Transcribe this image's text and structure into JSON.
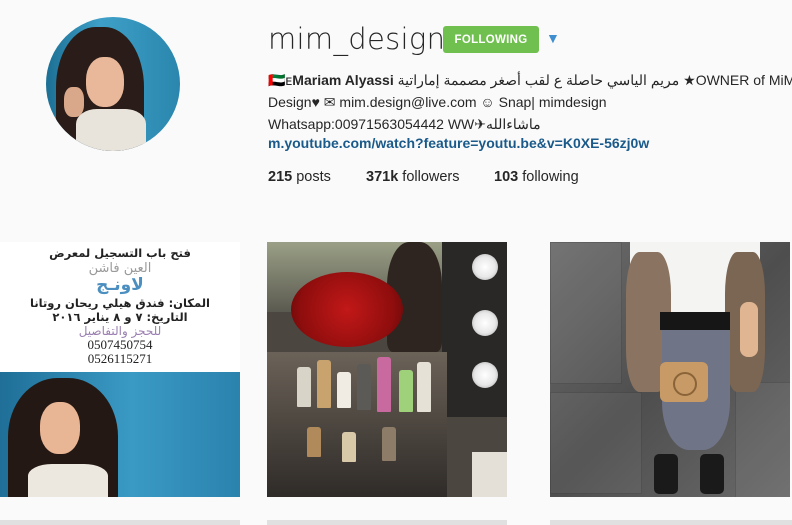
{
  "profile": {
    "username": "mim_design",
    "follow_label": "FOLLOWING",
    "dropdown_glyph": "▼",
    "bio": {
      "line1_prefix": "🇦🇪ᴇ",
      "full_name": "Mariam Alyassi",
      "line1_arabic": " مريم الياسي حاصلة ع لقب أصغر مصممة إماراتية ",
      "line1_suffix": "★OWNER of MiM",
      "line2": "Design♥ ✉ mim.design@live.com ☺ Snap| mimdesign",
      "line3": "Whatsapp:00971563054442 WW✈ماشاءالله"
    },
    "link": "m.youtube.com/watch?feature=youtu.be&v=K0XE-56zj0w",
    "stats": {
      "posts_count": "215",
      "posts_label": " posts",
      "followers_count": "371k",
      "followers_label": " followers",
      "following_count": "103",
      "following_label": " following"
    }
  },
  "posts": [
    {
      "name": "event-flyer-post",
      "text": {
        "line1": "فتح باب التسجيل لمعرض",
        "line2": "العين فاشن",
        "line3": "لاونـج",
        "line4": "المكان: فندق هيلي ريحان روتانا",
        "line5": "التاريخ: ٧ و ٨ يناير ٢٠١٦",
        "line6": "للحجز والتفاصيل",
        "phone1": "0507450754",
        "phone2": "0526115271"
      }
    },
    {
      "name": "roses-vanity-post"
    },
    {
      "name": "outfit-post"
    }
  ],
  "colors": {
    "follow_green": "#70c050",
    "link_blue": "#1a5a8a",
    "dropdown_blue": "#3f8ed0"
  }
}
